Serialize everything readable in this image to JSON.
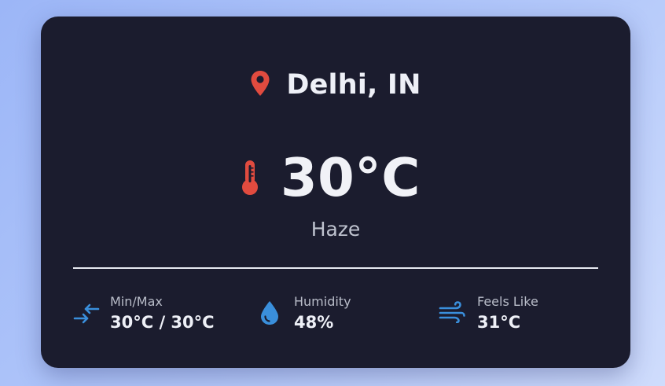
{
  "location": {
    "city": "Delhi, IN",
    "icon": "map-pin-icon"
  },
  "current": {
    "temperature": "30°C",
    "condition": "Haze",
    "icon": "thermometer-icon"
  },
  "details": [
    {
      "label": "Min/Max",
      "value": "30°C / 30°C",
      "icon": "min-max-arrows-icon"
    },
    {
      "label": "Humidity",
      "value": "48%",
      "icon": "water-drop-icon"
    },
    {
      "label": "Feels Like",
      "value": "31°C",
      "icon": "wind-icon"
    }
  ],
  "colors": {
    "card_background": "#1b1c2e",
    "accent_red": "#e14b3f",
    "accent_blue": "#3a8fdc"
  }
}
